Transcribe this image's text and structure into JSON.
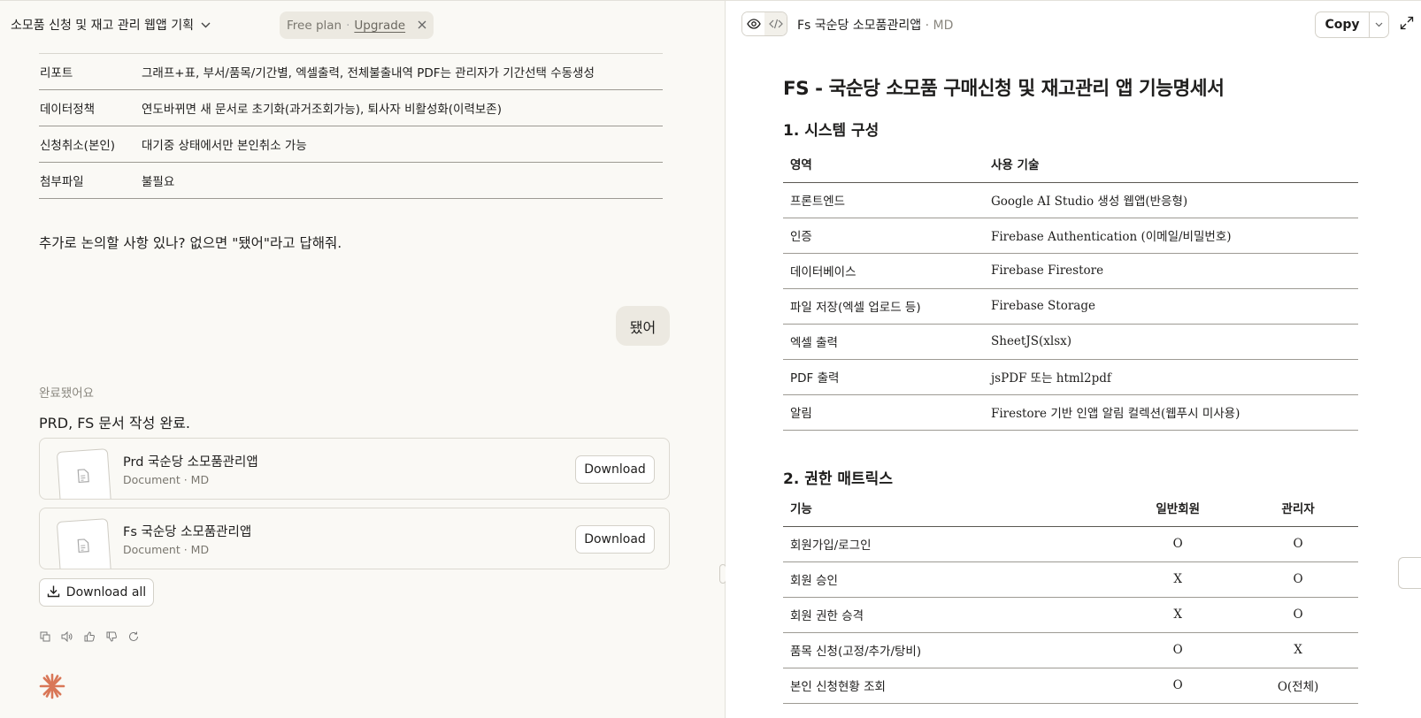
{
  "header": {
    "project_title": "소모품 신청 및 재고 관리 웹앱 기획",
    "plan_label": "Free plan",
    "plan_separator": "·",
    "upgrade_label": "Upgrade"
  },
  "chat": {
    "kv_rows": [
      {
        "key": "리포트",
        "value": "그래프+표, 부서/품목/기간별, 엑셀출력, 전체불출내역 PDF는 관리자가 기간선택 수동생성"
      },
      {
        "key": "데이터정책",
        "value": "연도바뀌면 새 문서로 초기화(과거조회가능), 퇴사자 비활성화(이력보존)"
      },
      {
        "key": "신청취소(본인)",
        "value": "대기중 상태에서만 본인취소 가능"
      },
      {
        "key": "첨부파일",
        "value": "불필요"
      }
    ],
    "question": "추가로 논의할 사항 있나? 없으면 \"됐어\"라고 답해줘.",
    "user_reply": "됐어",
    "status_label": "완료됐어요",
    "done_text": "PRD, FS 문서 작성 완료.",
    "files": [
      {
        "name": "Prd 국순당 소모품관리앱",
        "meta": "Document · MD",
        "button": "Download"
      },
      {
        "name": "Fs 국순당 소모품관리앱",
        "meta": "Document · MD",
        "button": "Download"
      }
    ],
    "download_all_label": "Download all"
  },
  "artifact": {
    "title": "Fs 국순당 소모품관리앱",
    "ext": "· MD",
    "copy_label": "Copy",
    "doc_h1": "FS - 국순당 소모품 구매신청 및 재고관리 앱 기능명세서",
    "section1_title": "1. 시스템 구성",
    "system_table": {
      "headers": [
        "영역",
        "사용 기술"
      ],
      "rows": [
        [
          "프론트엔드",
          "Google AI Studio 생성 웹앱(반응형)"
        ],
        [
          "인증",
          "Firebase Authentication (이메일/비밀번호)"
        ],
        [
          "데이터베이스",
          "Firebase Firestore"
        ],
        [
          "파일 저장(엑셀 업로드 등)",
          "Firebase Storage"
        ],
        [
          "엑셀 출력",
          "SheetJS(xlsx)"
        ],
        [
          "PDF 출력",
          "jsPDF 또는 html2pdf"
        ],
        [
          "알림",
          "Firestore 기반 인앱 알림 컬렉션(웹푸시 미사용)"
        ]
      ]
    },
    "section2_title": "2. 권한 매트릭스",
    "perm_table": {
      "headers": [
        "기능",
        "일반회원",
        "관리자"
      ],
      "rows": [
        [
          "회원가입/로그인",
          "O",
          "O"
        ],
        [
          "회원 승인",
          "X",
          "O"
        ],
        [
          "회원 권한 승격",
          "X",
          "O"
        ],
        [
          "품목 신청(고정/추가/탕비)",
          "O",
          "X"
        ],
        [
          "본인 신청현황 조회",
          "O",
          "O(전체)"
        ]
      ]
    }
  },
  "colors": {
    "accent": "#d97757",
    "background": "#faf9f5",
    "panel": "#ffffff"
  }
}
